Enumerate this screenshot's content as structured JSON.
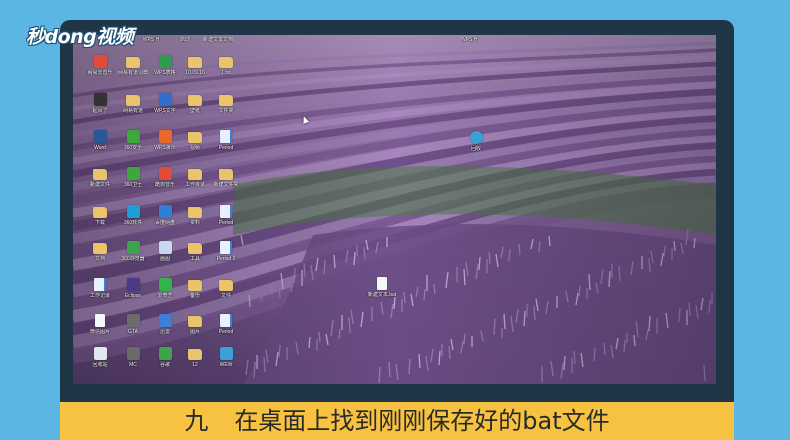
{
  "brand": {
    "logo_text": "秒dong视频"
  },
  "caption": {
    "step": "九",
    "text": "在桌面上找到刚刚保存好的bat文件"
  },
  "colors": {
    "frame": "#5bb6e4",
    "monitor": "#1f3646",
    "caption_bg": "#f7c242",
    "lavender": "#7c5a92",
    "foliage": "#4d7a45"
  },
  "desktop": {
    "top_partial_labels": [
      "WPS H",
      "启动",
      "新建文本文档"
    ],
    "icons": [
      {
        "label": "网易云音乐",
        "icon": "music-app-icon"
      },
      {
        "label": "网易有道词典",
        "icon": "folder-icon"
      },
      {
        "label": "WPS表格",
        "icon": "spreadsheet-app-icon"
      },
      {
        "label": "10.09.16",
        "icon": "folder-icon"
      },
      {
        "label": "1.txt",
        "icon": "folder-icon"
      },
      {
        "label": "起风了",
        "icon": "video-icon"
      },
      {
        "label": "网易有道",
        "icon": "folder-icon"
      },
      {
        "label": "WPS文字",
        "icon": "document-app-icon"
      },
      {
        "label": "壁纸",
        "icon": "folder-icon"
      },
      {
        "label": "文件夹",
        "icon": "folder-icon"
      },
      {
        "label": "Word",
        "icon": "word-app-icon"
      },
      {
        "label": "360安全",
        "icon": "security-app-icon"
      },
      {
        "label": "WPS演示",
        "icon": "slides-app-icon"
      },
      {
        "label": "视频",
        "icon": "folder-icon"
      },
      {
        "label": "Period",
        "icon": "document-icon"
      },
      {
        "label": "新建文件",
        "icon": "folder-icon"
      },
      {
        "label": "360卫士",
        "icon": "security-app-icon"
      },
      {
        "label": "酷狗音乐",
        "icon": "music-app-icon"
      },
      {
        "label": "工作目录",
        "icon": "folder-icon"
      },
      {
        "label": "新建文件夹",
        "icon": "folder-icon"
      },
      {
        "label": "下载",
        "icon": "folder-icon"
      },
      {
        "label": "360软件",
        "icon": "software-app-icon"
      },
      {
        "label": "百度网盘",
        "icon": "cloud-app-icon"
      },
      {
        "label": "资料",
        "icon": "folder-icon"
      },
      {
        "label": "Period",
        "icon": "document-icon"
      },
      {
        "label": "文档",
        "icon": "folder-icon"
      },
      {
        "label": "360浏览器",
        "icon": "browser-app-icon"
      },
      {
        "label": "画图",
        "icon": "paint-app-icon"
      },
      {
        "label": "工具",
        "icon": "folder-icon"
      },
      {
        "label": "Period 2",
        "icon": "document-icon"
      },
      {
        "label": "工作记录",
        "icon": "document-icon"
      },
      {
        "label": "Eclipse",
        "icon": "ide-app-icon"
      },
      {
        "label": "爱奇艺",
        "icon": "video-app-icon"
      },
      {
        "label": "备份",
        "icon": "folder-icon"
      },
      {
        "label": "文件",
        "icon": "folder-icon"
      },
      {
        "label": "微信图片",
        "icon": "image-icon"
      },
      {
        "label": "GTA",
        "icon": "game-app-icon"
      },
      {
        "label": "迅雷",
        "icon": "download-app-icon"
      },
      {
        "label": "图片",
        "icon": "folder-icon"
      },
      {
        "label": "Period",
        "icon": "document-icon"
      },
      {
        "label": "回收站",
        "icon": "recycle-bin-icon"
      },
      {
        "label": "MC",
        "icon": "game-app-icon"
      },
      {
        "label": "谷歌",
        "icon": "browser-app-icon"
      },
      {
        "label": "12",
        "icon": "folder-icon"
      },
      {
        "label": "WEW",
        "icon": "network-icon"
      }
    ],
    "loose_icons": [
      {
        "label": "回收",
        "icon": "network-icon"
      },
      {
        "label": "新建文本.bat",
        "icon": "bat-file-icon"
      }
    ]
  }
}
